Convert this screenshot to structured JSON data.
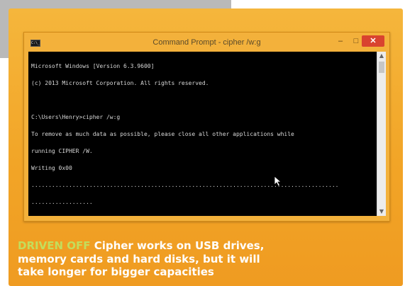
{
  "window": {
    "title": "Command Prompt - cipher  /w:g",
    "controls": {
      "minimize": "–",
      "maximize": "□",
      "close": "✕"
    },
    "icon_label": "C:\\_"
  },
  "console": {
    "lines": [
      "Microsoft Windows [Version 6.3.9600]",
      "(c) 2013 Microsoft Corporation. All rights reserved.",
      "",
      "C:\\Users\\Henry>cipher /w:g",
      "To remove as much data as possible, please close all other applications while",
      "running CIPHER /W.",
      "Writing 0x00",
      "..........................................................................................",
      ".................."
    ]
  },
  "caption": {
    "tag": "DRIVEN OFF",
    "text": " Cipher works on USB drives, memory cards and hard disks, but it will take longer for bigger capacities"
  },
  "colors": {
    "panel": "#f2a527",
    "console_bg": "#000000",
    "close_button": "#d9432f",
    "caption_tag": "#c2de5c"
  }
}
